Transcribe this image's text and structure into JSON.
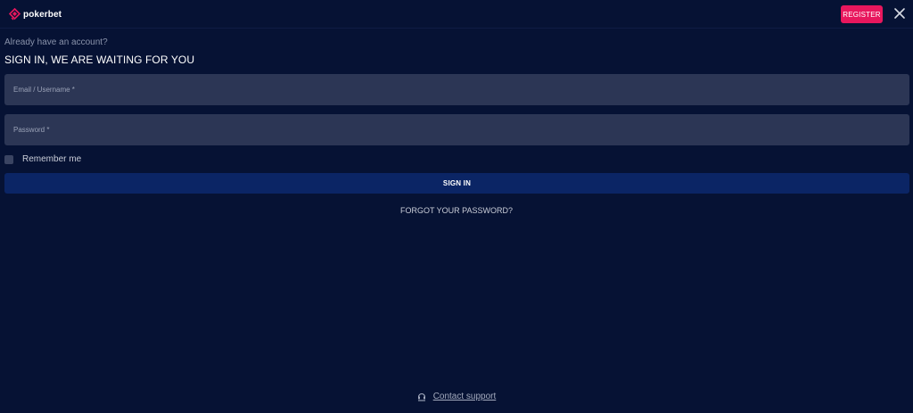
{
  "header": {
    "logo_text": "pokerbet",
    "logo_icon": "pokerbet-logo-icon",
    "register_label": "REGISTER",
    "close_icon": "close-icon"
  },
  "login": {
    "subtitle": "Already have an account?",
    "title": "SIGN IN, WE ARE WAITING FOR YOU",
    "email_placeholder": "Email / Username *",
    "email_value": "",
    "password_placeholder": "Password *",
    "password_value": "",
    "remember_label": "Remember me",
    "remember_checked": false,
    "signin_label": "SIGN IN",
    "forgot_label": "FORGOT YOUR PASSWORD?"
  },
  "footer": {
    "support_icon": "headset-icon",
    "support_label": "Contact support"
  },
  "colors": {
    "background": "#061234",
    "accent": "#e8175d",
    "field_bg": "#2c3655",
    "primary_button": "#0b2565"
  }
}
